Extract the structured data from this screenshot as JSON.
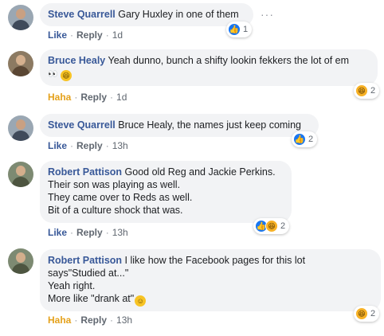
{
  "comments": [
    {
      "author": "Steve Quarrell",
      "text": "Gary Huxley in one of them",
      "reaction_label": "Like",
      "reply_label": "Reply",
      "time": "1d",
      "reactions": {
        "icons": [
          "like-icon"
        ],
        "count": "1"
      },
      "more_label": "···"
    },
    {
      "author": "Bruce Healy",
      "text_line1": "Yeah dunno, bunch a shifty lookin fekkers the lot of em",
      "text_line2": "👀",
      "reaction_label": "Haha",
      "reply_label": "Reply",
      "time": "1d",
      "reactions": {
        "icons": [
          "haha-icon"
        ],
        "count": "2"
      }
    },
    {
      "author": "Steve Quarrell",
      "text": "Bruce Healy, the names just keep coming",
      "reaction_label": "Like",
      "reply_label": "Reply",
      "time": "13h",
      "reactions": {
        "icons": [
          "like-icon"
        ],
        "count": "2"
      }
    },
    {
      "author": "Robert Pattison",
      "text": "Good old Reg and Jackie Perkins.\nTheir son was playing as well.\nThey came over to Reds as well.\nBit of a culture shock that was.",
      "reaction_label": "Like",
      "reply_label": "Reply",
      "time": "13h",
      "reactions": {
        "icons": [
          "like-icon",
          "haha-icon"
        ],
        "count": "2"
      }
    },
    {
      "author": "Robert Pattison",
      "text_line1": "I like how the Facebook pages for this lot",
      "text_rest": "says\"Studied at...\"\nYeah right.\nMore like \"drank at\"",
      "reaction_label": "Haha",
      "reply_label": "Reply",
      "time": "13h",
      "reactions": {
        "icons": [
          "haha-icon"
        ],
        "count": "2"
      }
    }
  ],
  "colors": {
    "author": "#385898",
    "like": "#385898",
    "haha": "#e4a11b",
    "bubble": "#f2f3f5",
    "meta": "#606770"
  }
}
